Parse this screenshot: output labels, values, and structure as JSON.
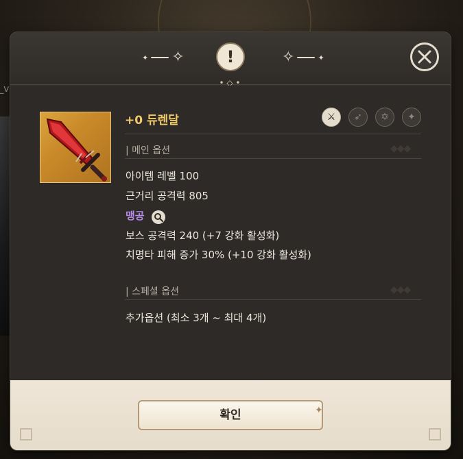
{
  "background": {
    "fragment_text": "_V"
  },
  "item": {
    "name": "+0 듀렌달",
    "class_icons": [
      {
        "icon": "crossed-swords-icon",
        "active": true
      },
      {
        "icon": "bow-icon",
        "active": false
      },
      {
        "icon": "hexagram-icon",
        "active": false
      },
      {
        "icon": "compass-star-icon",
        "active": false
      }
    ]
  },
  "main_options": {
    "title": "| 메인 옵션",
    "lines": [
      "아이템 레벨 100",
      "근거리 공격력 805"
    ],
    "special": "맹공",
    "bonus_lines": [
      "보스 공격력 240 (+7 강화 활성화)",
      "치명타 피해 증가 30% (+10 강화 활성화)"
    ]
  },
  "special_options": {
    "title": "| 스페셜 옵션",
    "lines": [
      "추가옵션 (최소 3개 ~ 최대 4개)"
    ]
  },
  "footer": {
    "confirm_label": "확인"
  },
  "colors": {
    "item_name": "#f0c96a",
    "special": "#b48be6",
    "panel": "#34302c"
  }
}
